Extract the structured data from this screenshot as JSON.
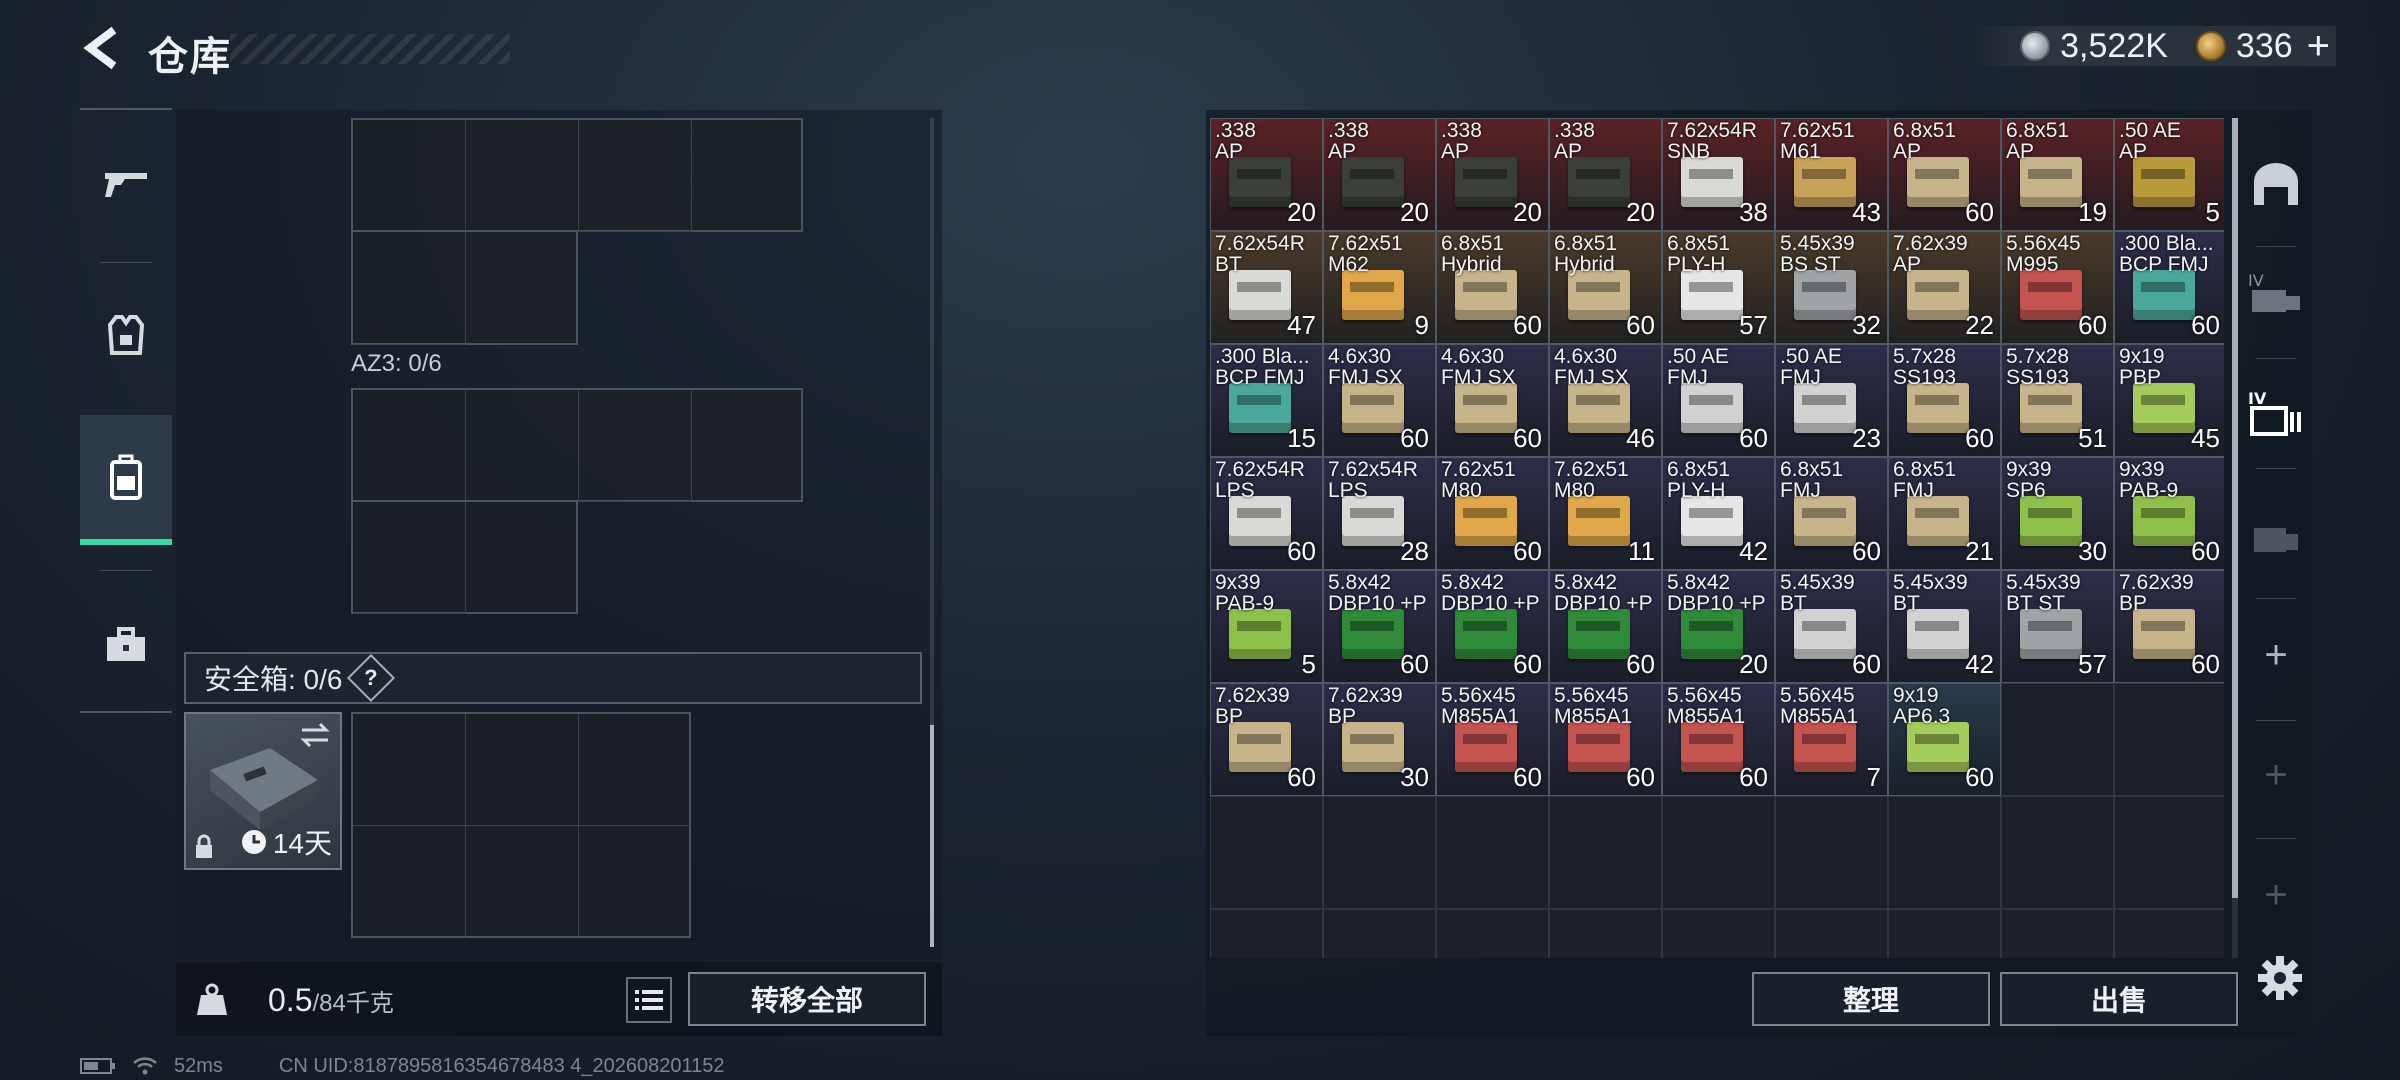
{
  "header": {
    "title": "仓库"
  },
  "currency": {
    "silver": "3,522K",
    "gold": "336",
    "plus_label": "+"
  },
  "left_nav": {
    "items": [
      "weapons-icon",
      "armor-icon",
      "backpack-icon",
      "toolbox-icon"
    ],
    "active": "backpack-icon"
  },
  "left_panel": {
    "az3_label": "AZ3: 0/6",
    "safe_box_label": "安全箱: 0/6",
    "safe_help": "?",
    "case_days": "14天"
  },
  "left_footer": {
    "weight_value": "0.5",
    "weight_max": "/84千克",
    "weight_icon_text": "KG",
    "transfer_all": "转移全部"
  },
  "right_footer": {
    "sort": "整理",
    "sell": "出售"
  },
  "status_bar": {
    "ping": "52ms",
    "uid": "CN UID:8187895816354678483 4_202608201152"
  },
  "items": [
    {
      "l1": ".338",
      "l2": "AP",
      "count": "20",
      "bg": "#5a2226",
      "box": "#3a3f3a"
    },
    {
      "l1": ".338",
      "l2": "AP",
      "count": "20",
      "bg": "#5a2226",
      "box": "#3a3f3a"
    },
    {
      "l1": ".338",
      "l2": "AP",
      "count": "20",
      "bg": "#5a2226",
      "box": "#3a3f3a"
    },
    {
      "l1": ".338",
      "l2": "AP",
      "count": "20",
      "bg": "#5a2226",
      "box": "#3a3f3a"
    },
    {
      "l1": "7.62x54R",
      "l2": "SNB",
      "count": "38",
      "bg": "#5a2226",
      "box": "#d9d9d6"
    },
    {
      "l1": "7.62x51",
      "l2": "M61",
      "count": "43",
      "bg": "#5a2226",
      "box": "#c9a259"
    },
    {
      "l1": "6.8x51",
      "l2": "AP",
      "count": "60",
      "bg": "#5a2226",
      "box": "#c8b48a"
    },
    {
      "l1": "6.8x51",
      "l2": "AP",
      "count": "19",
      "bg": "#5a2226",
      "box": "#c8b48a"
    },
    {
      "l1": ".50 AE",
      "l2": "AP",
      "count": "5",
      "bg": "#5a2226",
      "box": "#b99a3b"
    },
    {
      "l1": "7.62x54R",
      "l2": "BT",
      "count": "47",
      "bg": "#4a3b2a",
      "box": "#d9d9d6"
    },
    {
      "l1": "7.62x51",
      "l2": "M62",
      "count": "9",
      "bg": "#4a3b2a",
      "box": "#e0a84a"
    },
    {
      "l1": "6.8x51",
      "l2": "Hybrid",
      "count": "60",
      "bg": "#4a3b2a",
      "box": "#c8b48a"
    },
    {
      "l1": "6.8x51",
      "l2": "Hybrid",
      "count": "60",
      "bg": "#4a3b2a",
      "box": "#c8b48a"
    },
    {
      "l1": "6.8x51",
      "l2": "PLY-H",
      "count": "57",
      "bg": "#4a3b2a",
      "box": "#e6e6e6"
    },
    {
      "l1": "5.45x39",
      "l2": "BS ST",
      "count": "32",
      "bg": "#4a3b2a",
      "box": "#9fa4a6"
    },
    {
      "l1": "7.62x39",
      "l2": "AP",
      "count": "22",
      "bg": "#4a3b2a",
      "box": "#c8b48a"
    },
    {
      "l1": "5.56x45",
      "l2": "M995",
      "count": "60",
      "bg": "#4a3b2a",
      "box": "#c45450"
    },
    {
      "l1": ".300 Bla...",
      "l2": "BCP FMJ",
      "count": "60",
      "bg": "#2e2d4a",
      "box": "#4aa89a"
    },
    {
      "l1": ".300 Bla...",
      "l2": "BCP FMJ",
      "count": "15",
      "bg": "#2e2d4a",
      "box": "#4aa89a"
    },
    {
      "l1": "4.6x30",
      "l2": "FMJ SX",
      "count": "60",
      "bg": "#2e2d4a",
      "box": "#c8b48a"
    },
    {
      "l1": "4.6x30",
      "l2": "FMJ SX",
      "count": "60",
      "bg": "#2e2d4a",
      "box": "#c8b48a"
    },
    {
      "l1": "4.6x30",
      "l2": "FMJ SX",
      "count": "46",
      "bg": "#2e2d4a",
      "box": "#c8b48a"
    },
    {
      "l1": ".50 AE",
      "l2": "FMJ",
      "count": "60",
      "bg": "#2e2d4a",
      "box": "#d2d2d2"
    },
    {
      "l1": ".50 AE",
      "l2": "FMJ",
      "count": "23",
      "bg": "#2e2d4a",
      "box": "#d2d2d2"
    },
    {
      "l1": "5.7x28",
      "l2": "SS193",
      "count": "60",
      "bg": "#2e2d4a",
      "box": "#c8b48a"
    },
    {
      "l1": "5.7x28",
      "l2": "SS193",
      "count": "51",
      "bg": "#2e2d4a",
      "box": "#c8b48a"
    },
    {
      "l1": "9x19",
      "l2": "PBP",
      "count": "45",
      "bg": "#2e2d4a",
      "box": "#a4cc5a"
    },
    {
      "l1": "7.62x54R",
      "l2": "LPS",
      "count": "60",
      "bg": "#2e2d4a",
      "box": "#d9d9d6"
    },
    {
      "l1": "7.62x54R",
      "l2": "LPS",
      "count": "28",
      "bg": "#2e2d4a",
      "box": "#d9d9d6"
    },
    {
      "l1": "7.62x51",
      "l2": "M80",
      "count": "60",
      "bg": "#2e2d4a",
      "box": "#e0a84a"
    },
    {
      "l1": "7.62x51",
      "l2": "M80",
      "count": "11",
      "bg": "#2e2d4a",
      "box": "#e0a84a"
    },
    {
      "l1": "6.8x51",
      "l2": "PLY-H",
      "count": "42",
      "bg": "#2e2d4a",
      "box": "#e6e6e6"
    },
    {
      "l1": "6.8x51",
      "l2": "FMJ",
      "count": "60",
      "bg": "#2e2d4a",
      "box": "#c8b48a"
    },
    {
      "l1": "6.8x51",
      "l2": "FMJ",
      "count": "21",
      "bg": "#2e2d4a",
      "box": "#c8b48a"
    },
    {
      "l1": "9x39",
      "l2": "SP6",
      "count": "30",
      "bg": "#2e2d4a",
      "box": "#8fc04a"
    },
    {
      "l1": "9x39",
      "l2": "PAB-9",
      "count": "60",
      "bg": "#2e2d4a",
      "box": "#8fc04a"
    },
    {
      "l1": "9x39",
      "l2": "PAB-9",
      "count": "5",
      "bg": "#2e2d4a",
      "box": "#8fc04a"
    },
    {
      "l1": "5.8x42",
      "l2": "DBP10 +P",
      "count": "60",
      "bg": "#2e2d4a",
      "box": "#2f8a3a"
    },
    {
      "l1": "5.8x42",
      "l2": "DBP10 +P",
      "count": "60",
      "bg": "#2e2d4a",
      "box": "#2f8a3a"
    },
    {
      "l1": "5.8x42",
      "l2": "DBP10 +P",
      "count": "60",
      "bg": "#2e2d4a",
      "box": "#2f8a3a"
    },
    {
      "l1": "5.8x42",
      "l2": "DBP10 +P",
      "count": "20",
      "bg": "#2e2d4a",
      "box": "#2f8a3a"
    },
    {
      "l1": "5.45x39",
      "l2": "BT",
      "count": "60",
      "bg": "#2e2d4a",
      "box": "#d2d2d2"
    },
    {
      "l1": "5.45x39",
      "l2": "BT",
      "count": "42",
      "bg": "#2e2d4a",
      "box": "#d2d2d2"
    },
    {
      "l1": "5.45x39",
      "l2": "BT ST",
      "count": "57",
      "bg": "#2e2d4a",
      "box": "#9fa4a6"
    },
    {
      "l1": "7.62x39",
      "l2": "BP",
      "count": "60",
      "bg": "#2e2d4a",
      "box": "#c8b48a"
    },
    {
      "l1": "7.62x39",
      "l2": "BP",
      "count": "60",
      "bg": "#2e2d4a",
      "box": "#c8b48a"
    },
    {
      "l1": "7.62x39",
      "l2": "BP",
      "count": "30",
      "bg": "#2e2d4a",
      "box": "#c8b48a"
    },
    {
      "l1": "5.56x45",
      "l2": "M855A1",
      "count": "60",
      "bg": "#2e2d4a",
      "box": "#c45450"
    },
    {
      "l1": "5.56x45",
      "l2": "M855A1",
      "count": "60",
      "bg": "#2e2d4a",
      "box": "#c45450"
    },
    {
      "l1": "5.56x45",
      "l2": "M855A1",
      "count": "60",
      "bg": "#2e2d4a",
      "box": "#c45450"
    },
    {
      "l1": "5.56x45",
      "l2": "M855A1",
      "count": "7",
      "bg": "#2e2d4a",
      "box": "#c45450"
    },
    {
      "l1": "9x19",
      "l2": "AP6.3",
      "count": "60",
      "bg": "#2a3a4a",
      "box": "#a4cc5a"
    }
  ]
}
